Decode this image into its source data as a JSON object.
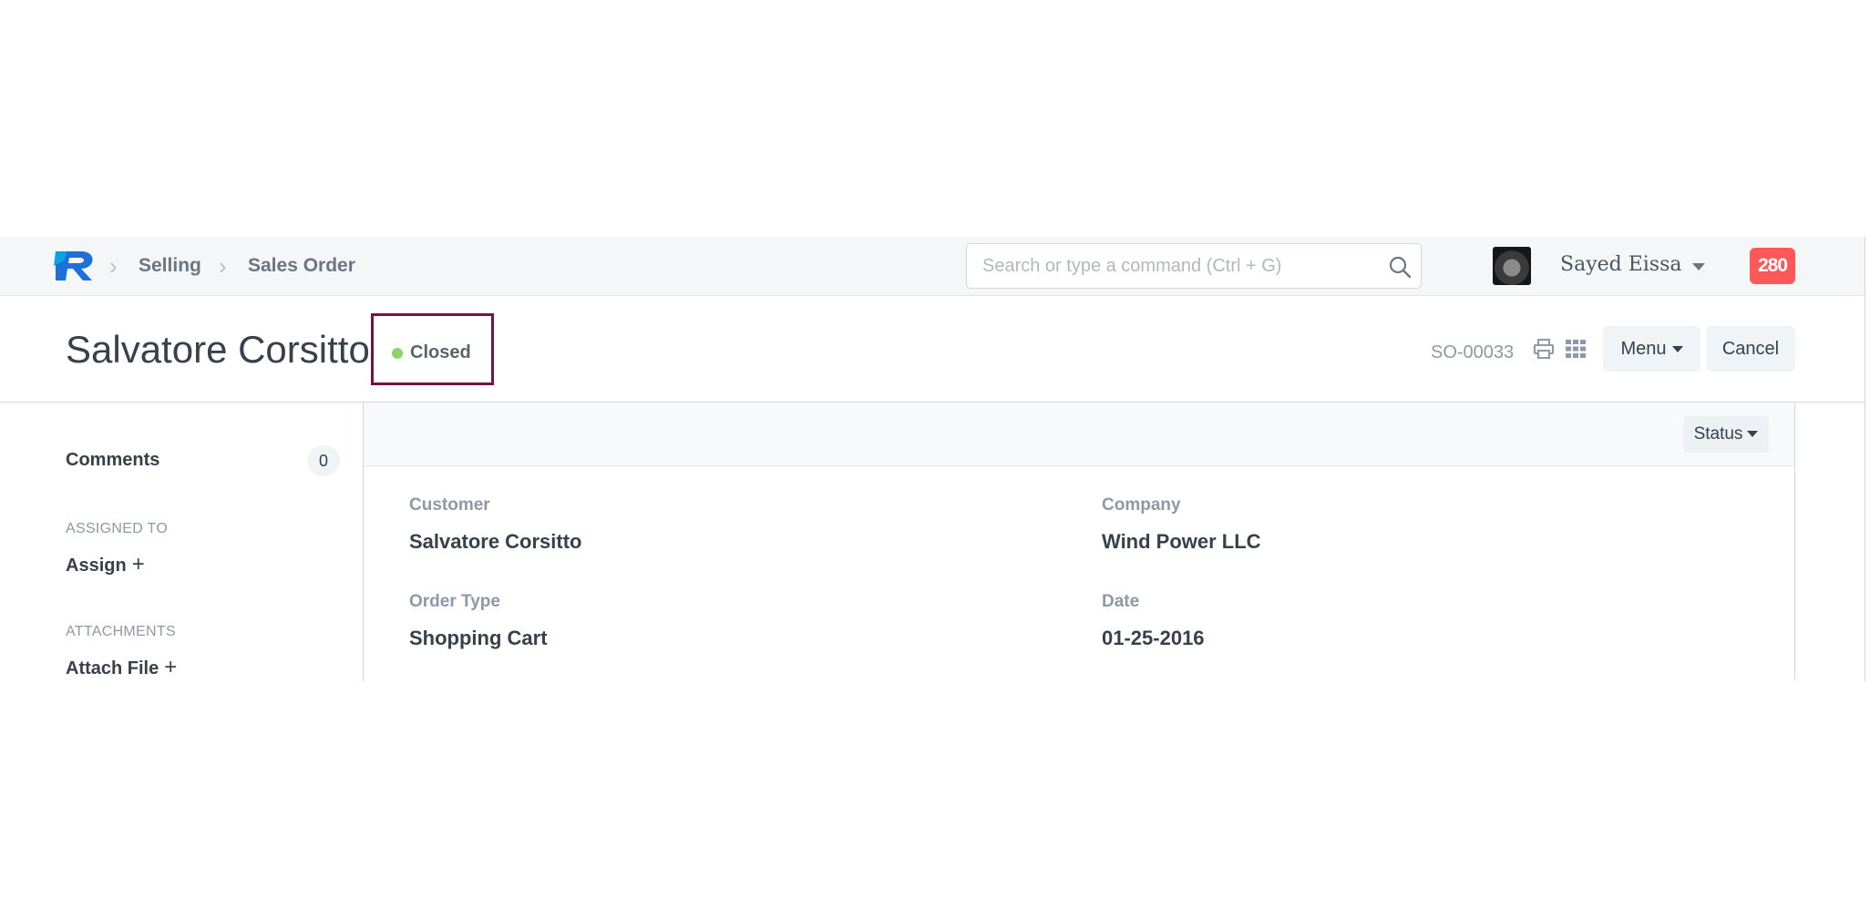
{
  "navbar": {
    "breadcrumbs": [
      "Selling",
      "Sales Order"
    ],
    "search_placeholder": "Search or type a command (Ctrl + G)",
    "user_name": "Sayed Eissa",
    "notification_count": "280",
    "brand_color": "#1e88e5",
    "badge_color": "#ff5858"
  },
  "page_head": {
    "title": "Salvatore Corsitto",
    "status": "Closed",
    "status_color": "#8ed26d",
    "highlight_color": "#7b1140",
    "doc_name": "SO-00033",
    "menu_label": "Menu",
    "cancel_label": "Cancel"
  },
  "sidebar": {
    "comments_label": "Comments",
    "comments_count": "0",
    "assigned_to_heading": "ASSIGNED TO",
    "assign_label": "Assign",
    "attachments_heading": "ATTACHMENTS",
    "attach_label": "Attach File"
  },
  "form": {
    "status_button": "Status",
    "fields": [
      {
        "label": "Customer",
        "value": "Salvatore Corsitto"
      },
      {
        "label": "Company",
        "value": "Wind Power LLC"
      },
      {
        "label": "Order Type",
        "value": "Shopping Cart"
      },
      {
        "label": "Date",
        "value": "01-25-2016"
      }
    ]
  }
}
